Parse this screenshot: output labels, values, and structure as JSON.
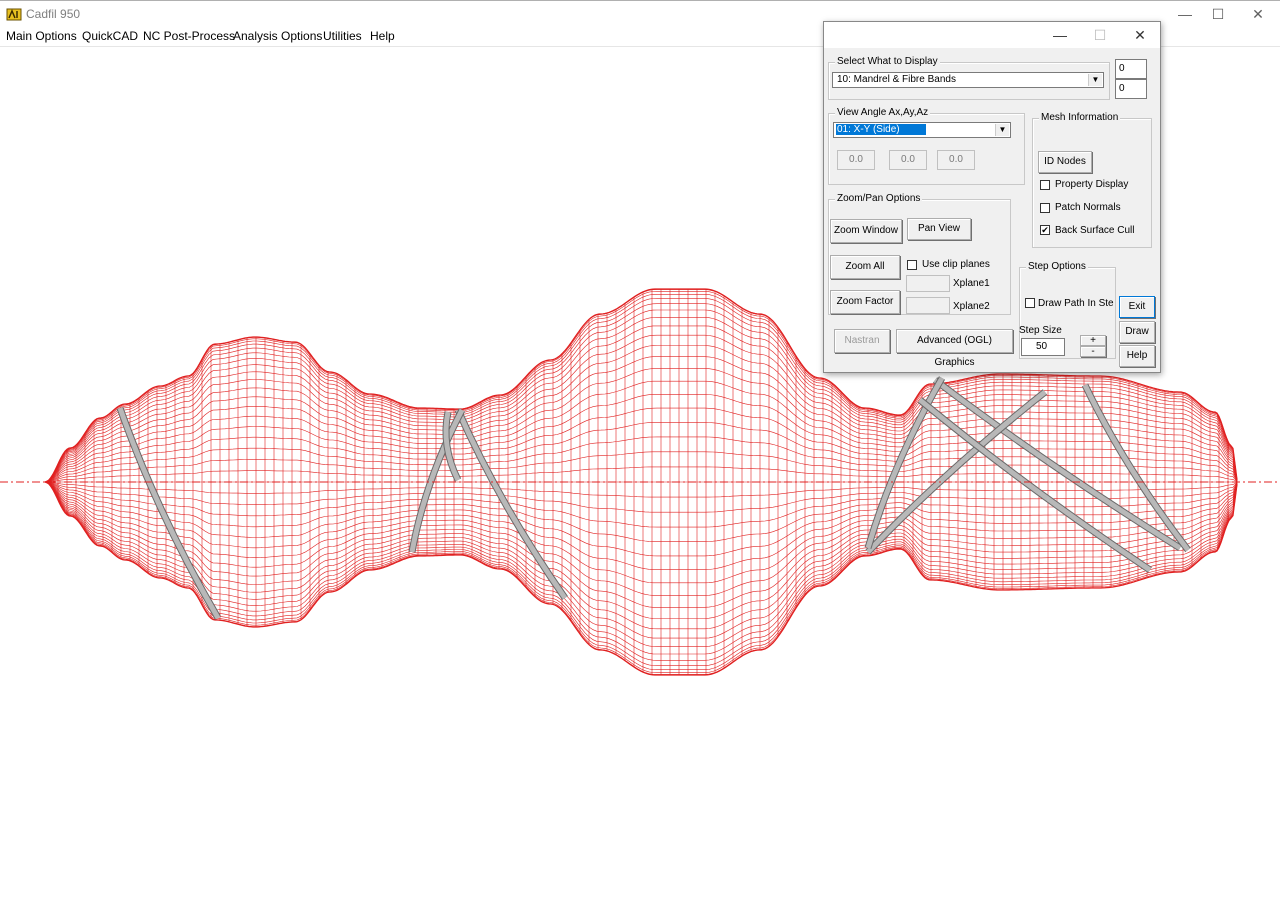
{
  "window": {
    "title": "Cadfil 950",
    "controls": [
      "—",
      "☐",
      "✕"
    ]
  },
  "menu": {
    "items": [
      "Main Options",
      "QuickCAD",
      "NC Post-Process",
      "Analysis Options",
      "Utilities",
      "Help"
    ]
  },
  "colors": {
    "mesh": "#e02020",
    "fibre": "#b8b8b8",
    "axis": "#e02020",
    "selection": "#0078d7"
  },
  "dialog": {
    "controls": [
      "—",
      "☐",
      "✕"
    ],
    "display": {
      "title": "Select What to Display",
      "selected": "10: Mandrel & Fibre Bands",
      "box1": "0",
      "box2": "0"
    },
    "view": {
      "title": "View Angle Ax,Ay,Az",
      "selected": "01: X-Y (Side)",
      "ax": "0.0",
      "ay": "0.0",
      "az": "0.0"
    },
    "mesh": {
      "title": "Mesh Information",
      "id_nodes": "ID Nodes",
      "property_display": "Property Display",
      "patch_normals": "Patch Normals",
      "back_surface_cull": "Back Surface Cull",
      "checked_mark": "✔"
    },
    "zoom": {
      "title": "Zoom/Pan Options",
      "zoom_window": "Zoom Window",
      "pan_view": "Pan View",
      "zoom_all": "Zoom All",
      "use_clip_planes": "Use clip planes",
      "xplane1": "Xplane1",
      "zoom_factor": "Zoom Factor",
      "xplane2": "Xplane2"
    },
    "nastran": "Nastran",
    "advanced": "Advanced (OGL) Graphics",
    "step": {
      "title": "Step Options",
      "draw_path": "Draw Path In Steps",
      "step_size_label": "Step Size",
      "step_size": "50",
      "plus": "+",
      "minus": "-"
    },
    "exit": "Exit",
    "draw": "Draw",
    "help": "Help"
  }
}
